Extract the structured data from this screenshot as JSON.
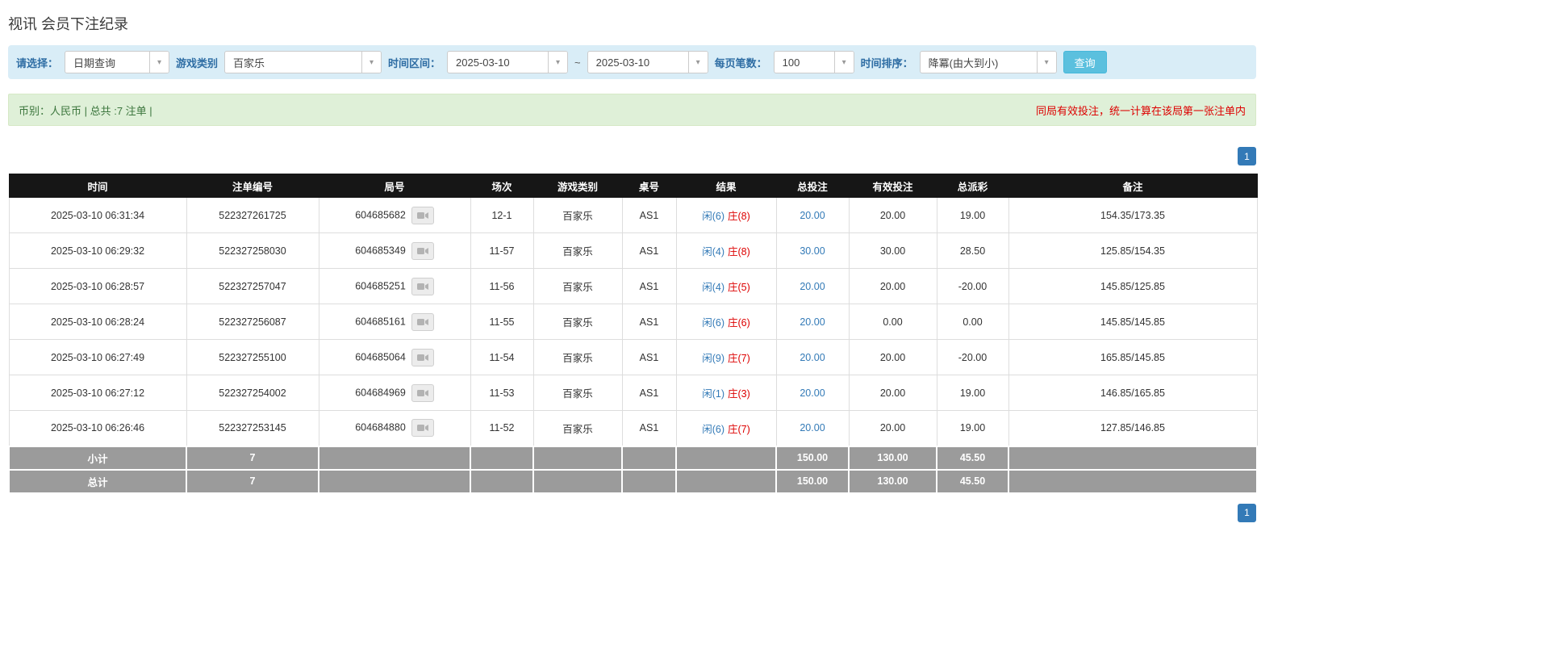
{
  "page": {
    "title": "视讯 会员下注纪录"
  },
  "filters": {
    "select_label": "请选择：",
    "select_value": "日期查询",
    "game_type_label": "游戏类别",
    "game_type_value": "百家乐",
    "date_range_label": "时间区间：",
    "date_from": "2025-03-10",
    "tilde": "~",
    "date_to": "2025-03-10",
    "page_size_label": "每页笔数：",
    "page_size_value": "100",
    "sort_label": "时间排序：",
    "sort_value": "降冪(由大到小)",
    "search_button": "查询"
  },
  "summary": {
    "left": "币别：人民币 | 总共 :7 注单 |",
    "right": "同局有效投注，统一计算在该局第一张注单内"
  },
  "pagination": {
    "page": "1"
  },
  "colors": {
    "accent_blue": "#337ab7",
    "negative_red": "#dd0000",
    "header_black": "#161616",
    "filter_bg": "#d9edf7",
    "summary_bg": "#dff0d8"
  },
  "table": {
    "headers": [
      "时间",
      "注单编号",
      "局号",
      "场次",
      "游戏类别",
      "桌号",
      "结果",
      "总投注",
      "有效投注",
      "总派彩",
      "备注"
    ],
    "rows": [
      {
        "time": "2025-03-10 06:31:34",
        "bet_id": "522327261725",
        "round": "604685682",
        "session": "12-1",
        "game": "百家乐",
        "table_no": "AS1",
        "player": "闲(6)",
        "banker": "庄(8)",
        "total_bet": "20.00",
        "valid_bet": "20.00",
        "payout": "19.00",
        "payout_state": "pos",
        "remark": "154.35/173.35"
      },
      {
        "time": "2025-03-10 06:29:32",
        "bet_id": "522327258030",
        "round": "604685349",
        "session": "11-57",
        "game": "百家乐",
        "table_no": "AS1",
        "player": "闲(4)",
        "banker": "庄(8)",
        "total_bet": "30.00",
        "valid_bet": "30.00",
        "payout": "28.50",
        "payout_state": "pos",
        "remark": "125.85/154.35"
      },
      {
        "time": "2025-03-10 06:28:57",
        "bet_id": "522327257047",
        "round": "604685251",
        "session": "11-56",
        "game": "百家乐",
        "table_no": "AS1",
        "player": "闲(4)",
        "banker": "庄(5)",
        "total_bet": "20.00",
        "valid_bet": "20.00",
        "payout": "-20.00",
        "payout_state": "neg",
        "remark": "145.85/125.85"
      },
      {
        "time": "2025-03-10 06:28:24",
        "bet_id": "522327256087",
        "round": "604685161",
        "session": "11-55",
        "game": "百家乐",
        "table_no": "AS1",
        "player": "闲(6)",
        "banker": "庄(6)",
        "total_bet": "20.00",
        "valid_bet": "0.00",
        "payout": "0.00",
        "payout_state": "pos",
        "remark": "145.85/145.85"
      },
      {
        "time": "2025-03-10 06:27:49",
        "bet_id": "522327255100",
        "round": "604685064",
        "session": "11-54",
        "game": "百家乐",
        "table_no": "AS1",
        "player": "闲(9)",
        "banker": "庄(7)",
        "total_bet": "20.00",
        "valid_bet": "20.00",
        "payout": "-20.00",
        "payout_state": "neg",
        "remark": "165.85/145.85"
      },
      {
        "time": "2025-03-10 06:27:12",
        "bet_id": "522327254002",
        "round": "604684969",
        "session": "11-53",
        "game": "百家乐",
        "table_no": "AS1",
        "player": "闲(1)",
        "banker": "庄(3)",
        "total_bet": "20.00",
        "valid_bet": "20.00",
        "payout": "19.00",
        "payout_state": "pos",
        "remark": "146.85/165.85"
      },
      {
        "time": "2025-03-10 06:26:46",
        "bet_id": "522327253145",
        "round": "604684880",
        "session": "11-52",
        "game": "百家乐",
        "table_no": "AS1",
        "player": "闲(6)",
        "banker": "庄(7)",
        "total_bet": "20.00",
        "valid_bet": "20.00",
        "payout": "19.00",
        "payout_state": "pos",
        "remark": "127.85/146.85"
      }
    ],
    "subtotal": {
      "label": "小计",
      "count": "7",
      "total_bet": "150.00",
      "valid_bet": "130.00",
      "payout": "45.50"
    },
    "total": {
      "label": "总计",
      "count": "7",
      "total_bet": "150.00",
      "valid_bet": "130.00",
      "payout": "45.50"
    }
  }
}
